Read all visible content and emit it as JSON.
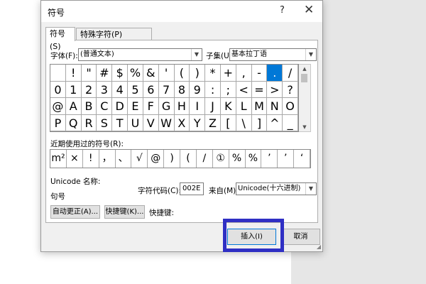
{
  "dialog": {
    "title": "符号",
    "help": "?",
    "close": "✕",
    "tabs": [
      "符号(S)",
      "特殊字符(P)"
    ]
  },
  "font": {
    "label": "字体(F):",
    "value": "(普通文本)"
  },
  "subset": {
    "label": "子集(U):",
    "value": "基本拉丁语"
  },
  "grid": {
    "rows": [
      [
        " ",
        "!",
        "\"",
        "#",
        "$",
        "%",
        "&",
        "'",
        "(",
        ")",
        "*",
        "+",
        ",",
        "-",
        ".",
        "/"
      ],
      [
        "0",
        "1",
        "2",
        "3",
        "4",
        "5",
        "6",
        "7",
        "8",
        "9",
        ":",
        ";",
        "<",
        "=",
        ">",
        "?"
      ],
      [
        "@",
        "A",
        "B",
        "C",
        "D",
        "E",
        "F",
        "G",
        "H",
        "I",
        "J",
        "K",
        "L",
        "M",
        "N",
        "O"
      ],
      [
        "P",
        "Q",
        "R",
        "S",
        "T",
        "U",
        "V",
        "W",
        "X",
        "Y",
        "Z",
        "[",
        "\\",
        "]",
        "^",
        "_"
      ]
    ],
    "selected": "."
  },
  "recent": {
    "label": "近期使用过的符号(R):",
    "symbols": [
      "m²",
      "×",
      "!",
      "，",
      "、",
      "√",
      "@",
      ")",
      "(",
      "/",
      "①",
      "%",
      "%",
      "’",
      "’",
      "‘"
    ]
  },
  "unicode_name_label": "Unicode 名称:",
  "char_name": "句号",
  "char_code": {
    "label": "字符代码(C):",
    "value": "002E"
  },
  "from": {
    "label": "来自(M):",
    "value": "Unicode(十六进制)"
  },
  "buttons": {
    "autocorrect": "自动更正(A)...",
    "shortcut": "快捷键(K)...",
    "shortcut_label": "快捷键:",
    "insert": "插入(I)",
    "cancel": "取消"
  },
  "colors": {
    "selected": "#0078d7",
    "highlight": "#2f2fc4"
  }
}
